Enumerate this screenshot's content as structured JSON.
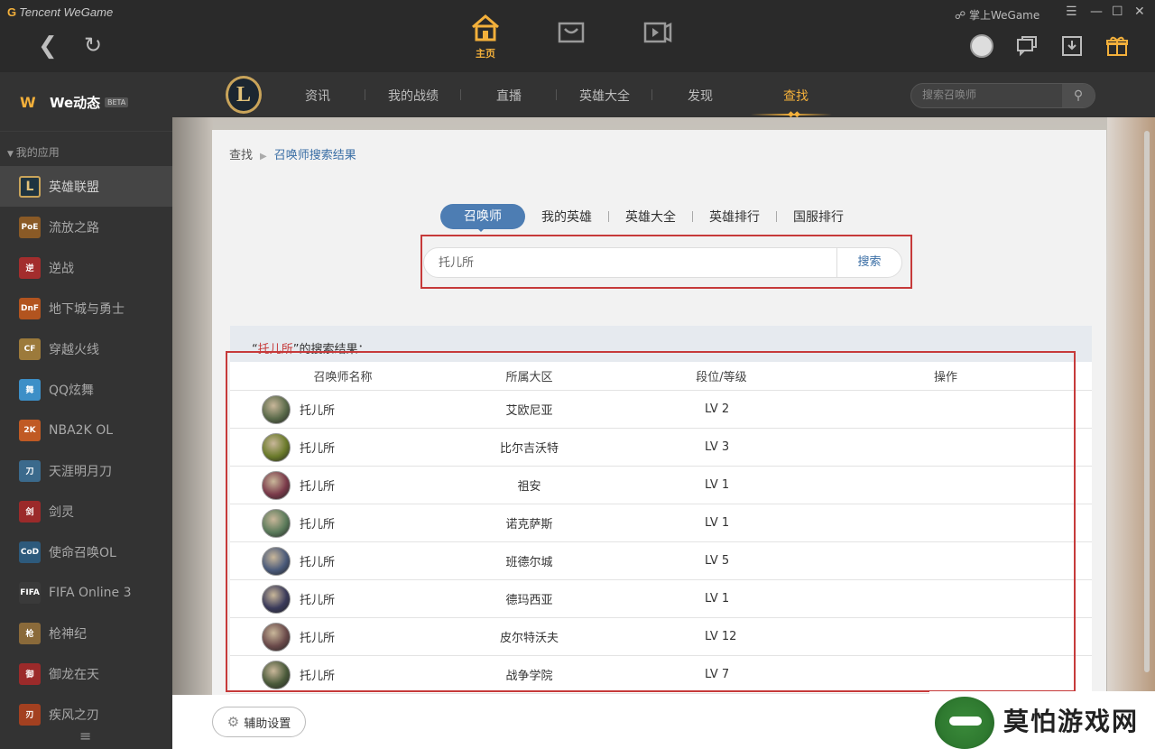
{
  "titlebar": {
    "brand": "Tencent WeGame",
    "mobile_label": "掌上WeGame",
    "min": "—",
    "max": "☐",
    "close": "✕",
    "menu": "☰"
  },
  "maintabs": [
    {
      "label": "主页",
      "icon": "home-icon"
    },
    {
      "label": "",
      "icon": "store-icon"
    },
    {
      "label": "",
      "icon": "video-icon"
    }
  ],
  "sidebar": {
    "header": "We动态",
    "beta": "BETA",
    "apps_heading": "我的应用",
    "apps": [
      {
        "label": "英雄联盟",
        "icon": "lol-icon",
        "color": "#1f3440"
      },
      {
        "label": "流放之路",
        "icon": "poe-icon",
        "color": "#8a5a26",
        "text": "PoE"
      },
      {
        "label": "逆战",
        "icon": "nizhan-icon",
        "color": "#a32d2d",
        "text": "逆"
      },
      {
        "label": "地下城与勇士",
        "icon": "dnf-icon",
        "color": "#b2541f",
        "text": "DnF"
      },
      {
        "label": "穿越火线",
        "icon": "cf-icon",
        "color": "#9c7a3b",
        "text": "CF"
      },
      {
        "label": "QQ炫舞",
        "icon": "qqdance-icon",
        "color": "#3d8fc7",
        "text": "舞"
      },
      {
        "label": "NBA2K OL",
        "icon": "nba-icon",
        "color": "#c05a24",
        "text": "2K"
      },
      {
        "label": "天涯明月刀",
        "icon": "tianya-icon",
        "color": "#3b6a8c",
        "text": "刀"
      },
      {
        "label": "剑灵",
        "icon": "jianling-icon",
        "color": "#9b2a2a",
        "text": "剑"
      },
      {
        "label": "使命召唤OL",
        "icon": "codol-icon",
        "color": "#2d5a7c",
        "text": "CoD"
      },
      {
        "label": "FIFA Online 3",
        "icon": "fifa-icon",
        "color": "#3a3a3a",
        "text": "FIFA"
      },
      {
        "label": "枪神纪",
        "icon": "qsj-icon",
        "color": "#8a6a3a",
        "text": "枪"
      },
      {
        "label": "御龙在天",
        "icon": "yulong-icon",
        "color": "#9b2a2a",
        "text": "御"
      },
      {
        "label": "疾风之刃",
        "icon": "jifeng-icon",
        "color": "#a34020",
        "text": "刃"
      }
    ]
  },
  "subnav": {
    "items": [
      "资讯",
      "我的战绩",
      "直播",
      "英雄大全",
      "发现",
      "查找"
    ],
    "active_index": 5,
    "search_placeholder": "搜索召唤师"
  },
  "breadcrumb": {
    "root": "查找",
    "current": "召唤师搜索结果"
  },
  "find_tabs": [
    "召唤师",
    "我的英雄",
    "英雄大全",
    "英雄排行",
    "国服排行"
  ],
  "search": {
    "value": "托儿所",
    "button": "搜索"
  },
  "results": {
    "prefix": "“",
    "keyword": "托儿所",
    "suffix": "”的搜索结果：",
    "columns": [
      "召唤师名称",
      "所属大区",
      "段位/等级",
      "操作"
    ],
    "rows": [
      {
        "name": "托儿所",
        "region": "艾欧尼亚",
        "level": "LV 2",
        "avatar": "#5a6a4a"
      },
      {
        "name": "托儿所",
        "region": "比尔吉沃特",
        "level": "LV 3",
        "avatar": "#6a7a2a"
      },
      {
        "name": "托儿所",
        "region": "祖安",
        "level": "LV 1",
        "avatar": "#7a3a4a"
      },
      {
        "name": "托儿所",
        "region": "诺克萨斯",
        "level": "LV 1",
        "avatar": "#5a7a5a"
      },
      {
        "name": "托儿所",
        "region": "班德尔城",
        "level": "LV 5",
        "avatar": "#4a5a7a"
      },
      {
        "name": "托儿所",
        "region": "德玛西亚",
        "level": "LV 1",
        "avatar": "#3a3a5a"
      },
      {
        "name": "托儿所",
        "region": "皮尔特沃夫",
        "level": "LV 12",
        "avatar": "#6a4a4a"
      },
      {
        "name": "托儿所",
        "region": "战争学院",
        "level": "LV 7",
        "avatar": "#4a5a3a"
      }
    ]
  },
  "bottom": {
    "assist_label": "辅助设置"
  },
  "watermark": {
    "text": "莫怕游戏网"
  }
}
